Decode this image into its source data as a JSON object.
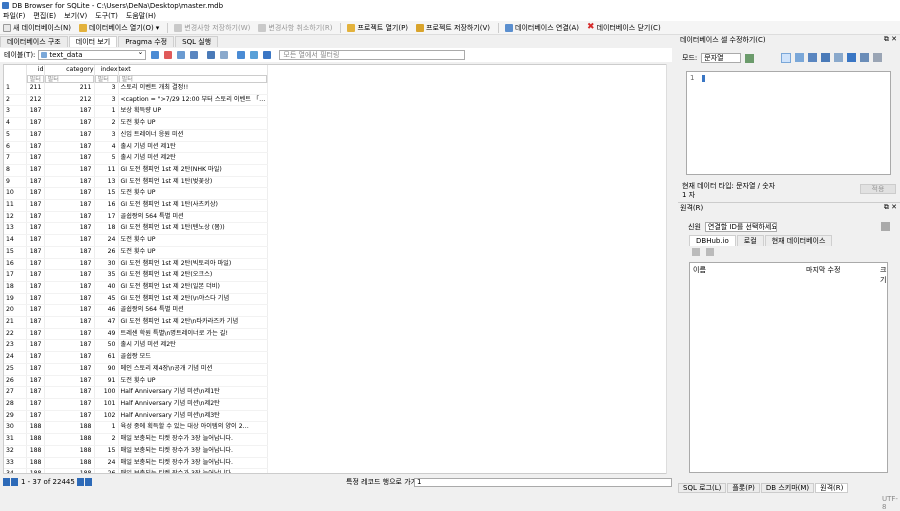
{
  "window": {
    "title": "DB Browser for SQLite - C:\\Users\\DeNa\\Desktop\\master.mdb"
  },
  "menu": [
    "파일(F)",
    "편집(E)",
    "보기(V)",
    "도구(T)",
    "도움말(H)"
  ],
  "toolbar": {
    "new_db": "새 데이터베이스(N)",
    "open_db": "데이터베이스 열기(O)",
    "write_changes": "변경사항 저장하기(W)",
    "revert_changes": "변경사항 취소하기(R)",
    "open_project": "프로젝트 열기(P)",
    "save_project": "프로젝트 저장하기(V)",
    "attach_db": "데이터베이스 연결(A)",
    "close_db": "데이터베이스 닫기(C)"
  },
  "tabs": [
    "데이터베이스 구조",
    "데이터 보기",
    "Pragma 수정",
    "SQL 실행"
  ],
  "table_bar": {
    "label": "테이블(T):",
    "selected": "text_data",
    "filter_placeholder": "모든 열에서 필터링"
  },
  "grid": {
    "columns": [
      "",
      "id",
      "category",
      "index",
      "text"
    ],
    "filter_placeholder": "필터",
    "rows": [
      [
        "1",
        "211",
        "211",
        "3",
        "스토리 이벤트 개최 결정!!"
      ],
      [
        "2",
        "212",
        "212",
        "3",
        "<caption = \">7/29 12:00 부터 스토리 이벤트 「…"
      ],
      [
        "3",
        "187",
        "187",
        "1",
        "보상 획득량 UP"
      ],
      [
        "4",
        "187",
        "187",
        "2",
        "도전 횟수 UP"
      ],
      [
        "5",
        "187",
        "187",
        "3",
        "신입 트레이너 응원 미션"
      ],
      [
        "6",
        "187",
        "187",
        "4",
        "출시 기념 미션 제1탄"
      ],
      [
        "7",
        "187",
        "187",
        "5",
        "출시 기념 미션 제2탄"
      ],
      [
        "8",
        "187",
        "187",
        "11",
        "GI 도전 챔피언 1st 제 2탄(NHK 마일)"
      ],
      [
        "9",
        "187",
        "187",
        "13",
        "GI 도전 챔피언 1st 제 1탄(벚꽃상)"
      ],
      [
        "10",
        "187",
        "187",
        "15",
        "도전 횟수 UP"
      ],
      [
        "11",
        "187",
        "187",
        "16",
        "GI 도전 챔피언 1st 제 1탄(사츠키상)"
      ],
      [
        "12",
        "187",
        "187",
        "17",
        "골쉽짱의 564 특별 미션"
      ],
      [
        "13",
        "187",
        "187",
        "18",
        "GI 도전 챔피언 1st 제 1탄(텐노상 (봄))"
      ],
      [
        "14",
        "187",
        "187",
        "24",
        "도전 횟수 UP"
      ],
      [
        "15",
        "187",
        "187",
        "26",
        "도전 횟수 UP"
      ],
      [
        "16",
        "187",
        "187",
        "30",
        "GI 도전 챔피언 1st 제 2탄(빅토리아 마일)"
      ],
      [
        "17",
        "187",
        "187",
        "35",
        "GI 도전 챔피언 1st 제 2탄(오크스)"
      ],
      [
        "18",
        "187",
        "187",
        "40",
        "GI 도전 챔피언 1st 제 2탄(일본 더비)"
      ],
      [
        "19",
        "187",
        "187",
        "45",
        "GI 도전 챔피언 1st 제 2탄(\\n야스다 기념"
      ],
      [
        "20",
        "187",
        "187",
        "46",
        "골쉽짱의 564 특별 미션"
      ],
      [
        "21",
        "187",
        "187",
        "47",
        "GI 도전 챔피언 1st 제 2탄\\n타카라즈카 기념"
      ],
      [
        "22",
        "187",
        "187",
        "49",
        "트레센 학원 특별\\n명트레이너로 가는 길!"
      ],
      [
        "23",
        "187",
        "187",
        "50",
        "출시 기념 미션 제2탄"
      ],
      [
        "24",
        "187",
        "187",
        "61",
        "골쉽짱 모드"
      ],
      [
        "25",
        "187",
        "187",
        "90",
        "메인 스토리 제4장\\n공개 기념 미션"
      ],
      [
        "26",
        "187",
        "187",
        "91",
        "도전 횟수 UP"
      ],
      [
        "27",
        "187",
        "187",
        "100",
        "Half Anniversary 기념 미션\\n제1탄"
      ],
      [
        "28",
        "187",
        "187",
        "101",
        "Half Anniversary 기념 미션\\n제2탄"
      ],
      [
        "29",
        "187",
        "187",
        "102",
        "Half Anniversary 기념 미션\\n제3탄"
      ],
      [
        "30",
        "188",
        "188",
        "1",
        "육성 중에 획득할 수 있는 대상 아이템의 양이 2…"
      ],
      [
        "31",
        "188",
        "188",
        "2",
        "매일 보충되는 티켓 장수가 3장 늘어납니다."
      ],
      [
        "32",
        "188",
        "188",
        "15",
        "매일 보충되는 티켓 장수가 3장 늘어납니다."
      ],
      [
        "33",
        "188",
        "188",
        "24",
        "매일 보충되는 티켓 장수가 3장 늘어납니다."
      ],
      [
        "34",
        "188",
        "188",
        "26",
        "매일 보충되는 티켓 장수가 3장 늘어납니다."
      ],
      [
        "35",
        "188",
        "188",
        "61",
        "이 모드로 육성하면, 육성한 우마무스메의\\n육…"
      ],
      [
        "36",
        "188",
        "188",
        "91",
        "매일 보충되는 티켓 장수가 3장 늘어납니다."
      ]
    ]
  },
  "statusbar": {
    "range": "1 - 37 of 22445",
    "goto_label": "특정 레코드 행으로 가기:",
    "goto_value": "1"
  },
  "edit_panel": {
    "title": "데이터베이스 셀 수정하기(C)",
    "mode_label": "모드:",
    "mode_value": "문자열",
    "line_no": "1",
    "type_info": "현재 데이터 타입: 문자열 / 숫자",
    "size_info": "1 자",
    "apply": "적용"
  },
  "remote_panel": {
    "title": "원격(R)",
    "identity_label": "신원",
    "identity_value": "연결할 ID를 선택하세요",
    "tabs": [
      "DBHub.io",
      "로컬",
      "현재 데이터베이스"
    ],
    "columns": [
      "이름",
      "마지막 수정",
      "크기"
    ]
  },
  "bottom_tabs": [
    "SQL 로그(L)",
    "플롯(P)",
    "DB 스키마(M)",
    "원격(R)"
  ],
  "encoding": "UTF-8",
  "colors": {
    "accent": "#3a76c4",
    "select_bg": "#cfe3fb"
  }
}
